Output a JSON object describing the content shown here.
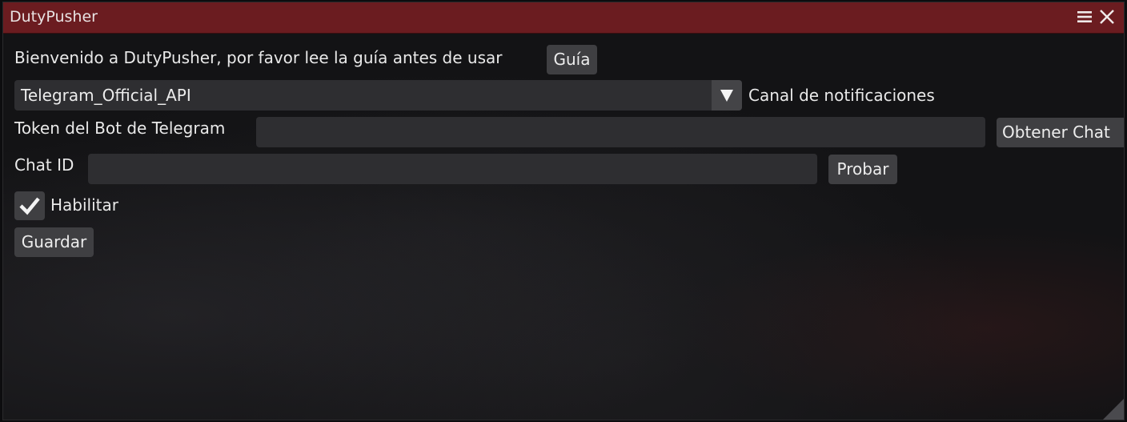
{
  "window": {
    "title": "DutyPusher",
    "titlebar_color": "#6b1c20",
    "menu_icon": "hamburger-menu-icon",
    "close_icon": "close-icon"
  },
  "welcome": {
    "text": "Bienvenido a DutyPusher, por favor lee la guía antes de usar",
    "guide_button": "Guía"
  },
  "channel": {
    "selected": "Telegram_Official_API",
    "label": "Canal de notificaciones",
    "dropdown_icon": "triangle-down-icon"
  },
  "bot_token": {
    "label": "Token del Bot de Telegram",
    "value": "",
    "get_chat_button": "Obtener Chat"
  },
  "chat_id": {
    "label": "Chat ID",
    "value": "",
    "test_button": "Probar"
  },
  "enable": {
    "label": "Habilitar",
    "checked": true,
    "check_icon": "checkmark-icon"
  },
  "save_button": "Guardar"
}
